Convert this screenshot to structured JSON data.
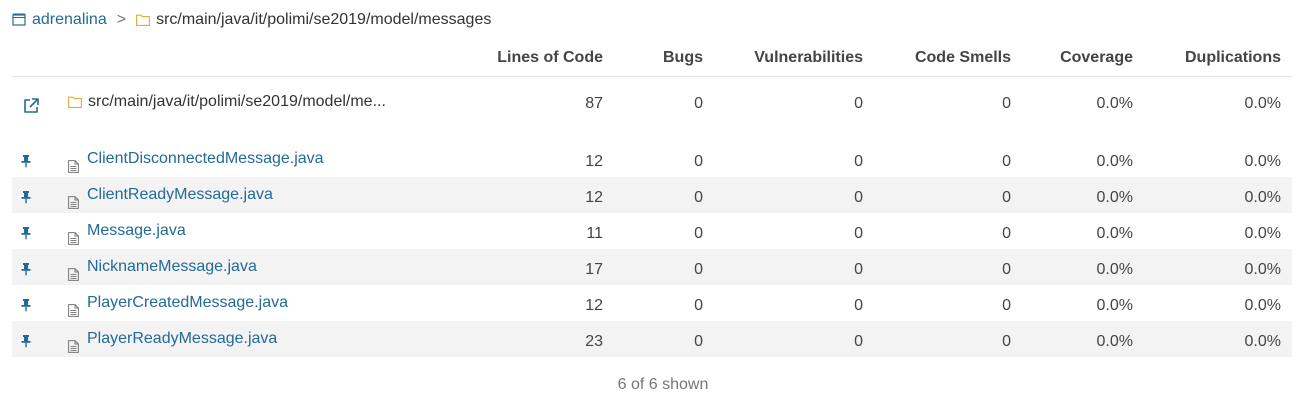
{
  "breadcrumb": {
    "project": "adrenalina",
    "separator": ">",
    "path": "src/main/java/it/polimi/se2019/model/messages"
  },
  "columns": {
    "lines_of_code": "Lines of Code",
    "bugs": "Bugs",
    "vulnerabilities": "Vulnerabilities",
    "code_smells": "Code Smells",
    "coverage": "Coverage",
    "duplications": "Duplications"
  },
  "folder": {
    "name": "src/main/java/it/polimi/se2019/model/me...",
    "lines_of_code": "87",
    "bugs": "0",
    "vulnerabilities": "0",
    "code_smells": "0",
    "coverage": "0.0%",
    "duplications": "0.0%"
  },
  "files": [
    {
      "name": "ClientDisconnectedMessage.java",
      "lines_of_code": "12",
      "bugs": "0",
      "vulnerabilities": "0",
      "code_smells": "0",
      "coverage": "0.0%",
      "duplications": "0.0%"
    },
    {
      "name": "ClientReadyMessage.java",
      "lines_of_code": "12",
      "bugs": "0",
      "vulnerabilities": "0",
      "code_smells": "0",
      "coverage": "0.0%",
      "duplications": "0.0%"
    },
    {
      "name": "Message.java",
      "lines_of_code": "11",
      "bugs": "0",
      "vulnerabilities": "0",
      "code_smells": "0",
      "coverage": "0.0%",
      "duplications": "0.0%"
    },
    {
      "name": "NicknameMessage.java",
      "lines_of_code": "17",
      "bugs": "0",
      "vulnerabilities": "0",
      "code_smells": "0",
      "coverage": "0.0%",
      "duplications": "0.0%"
    },
    {
      "name": "PlayerCreatedMessage.java",
      "lines_of_code": "12",
      "bugs": "0",
      "vulnerabilities": "0",
      "code_smells": "0",
      "coverage": "0.0%",
      "duplications": "0.0%"
    },
    {
      "name": "PlayerReadyMessage.java",
      "lines_of_code": "23",
      "bugs": "0",
      "vulnerabilities": "0",
      "code_smells": "0",
      "coverage": "0.0%",
      "duplications": "0.0%"
    }
  ],
  "footer": {
    "shown": "6 of 6 shown"
  },
  "colors": {
    "link": "#236a97",
    "folder_icon": "#e8a83a",
    "alt_row": "#f3f3f3"
  },
  "icons": {
    "project": "project-icon",
    "folder": "folder-icon",
    "open": "external-link-icon",
    "pin": "pin-icon",
    "file": "file-icon"
  }
}
